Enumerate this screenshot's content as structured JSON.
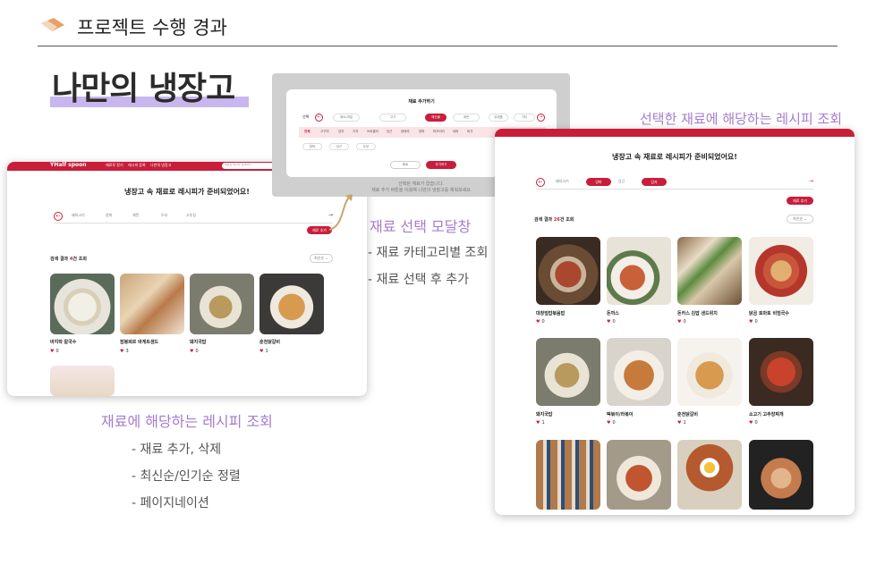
{
  "slide": {
    "title": "프로젝트 수행 경과",
    "hero": "나만의 냉장고"
  },
  "left_panel": {
    "logo": "YHalf spoon",
    "nav": [
      "재료로 찾기",
      "레시피 등록",
      "나만의 냉장고"
    ],
    "search_placeholder": "재료로 레시피 검색하기",
    "heading": "냉장고 속 재료로 레시피가 준비되었어요!",
    "chips": [
      "돼지고기",
      "양파",
      "계란",
      "두부",
      "고추장"
    ],
    "add_button": "재료 추가",
    "result_prefix": "검색 결과 ",
    "result_count": "4",
    "result_suffix": "건 조회",
    "sort": "최신순",
    "recipes": [
      {
        "name": "바지락 칼국수",
        "likes": "0"
      },
      {
        "name": "잠봉뵈르 바게트샌드",
        "likes": "3"
      },
      {
        "name": "돼지국밥",
        "likes": "0"
      },
      {
        "name": "춘천닭갈비",
        "likes": "1"
      }
    ],
    "caption": "재료에 해당하는 레시피 조회",
    "bullets": [
      "- 재료 추가, 삭제",
      "- 최신순/인기순 정렬",
      "- 페이지네이션"
    ]
  },
  "modal": {
    "title": "재료 추가하기",
    "tab_label": "선택",
    "categories": [
      "채소/과일",
      "고기",
      "해산물",
      "계란",
      "유제품",
      "기타"
    ],
    "subcats": [
      "전체",
      "고구마",
      "감자",
      "가지",
      "브로콜리",
      "당근",
      "양배추",
      "양파",
      "파프리카",
      "대파",
      "버섯"
    ],
    "selected": [
      "양파",
      "당근",
      "두부"
    ],
    "cancel": "취소",
    "confirm": "추가하기",
    "behind_line1": "선택된 재료가 없습니다.",
    "behind_line2": "재료 추가 버튼을 이용해 나만의 냉장고를 채워보세요",
    "caption": "재료 선택 모달창",
    "bullets": [
      "- 재료 카테고리별 조회",
      "- 재료 선택 후 추가"
    ]
  },
  "right_panel": {
    "caption": "선택한 재료에 해당하는 레시피 조회",
    "heading": "냉장고 속 재료로 레시피가 준비되었어요!",
    "chips": [
      "돼지고기",
      "양파",
      "당근",
      "감자"
    ],
    "add_button": "재료 추가",
    "result_prefix": "검색 결과 ",
    "result_count": "26",
    "result_suffix": "건 조회",
    "sort": "최신순",
    "recipes": [
      {
        "name": "대창덮밥볶음밥",
        "likes": "0"
      },
      {
        "name": "돈까스",
        "likes": "0"
      },
      {
        "name": "돈카스 김밥 샌드위치",
        "likes": "0"
      },
      {
        "name": "닭곰 토마토 비빔국수",
        "likes": "0"
      },
      {
        "name": "돼지국밥",
        "likes": "1"
      },
      {
        "name": "떡볶이/라볶이",
        "likes": "0"
      },
      {
        "name": "춘천닭갈비",
        "likes": "1"
      },
      {
        "name": "소고기 고추장찌개",
        "likes": "0"
      }
    ]
  },
  "colors": {
    "accent": "#c81e3a",
    "caption": "#a57ccf",
    "highlight": "#c7b7ee"
  }
}
